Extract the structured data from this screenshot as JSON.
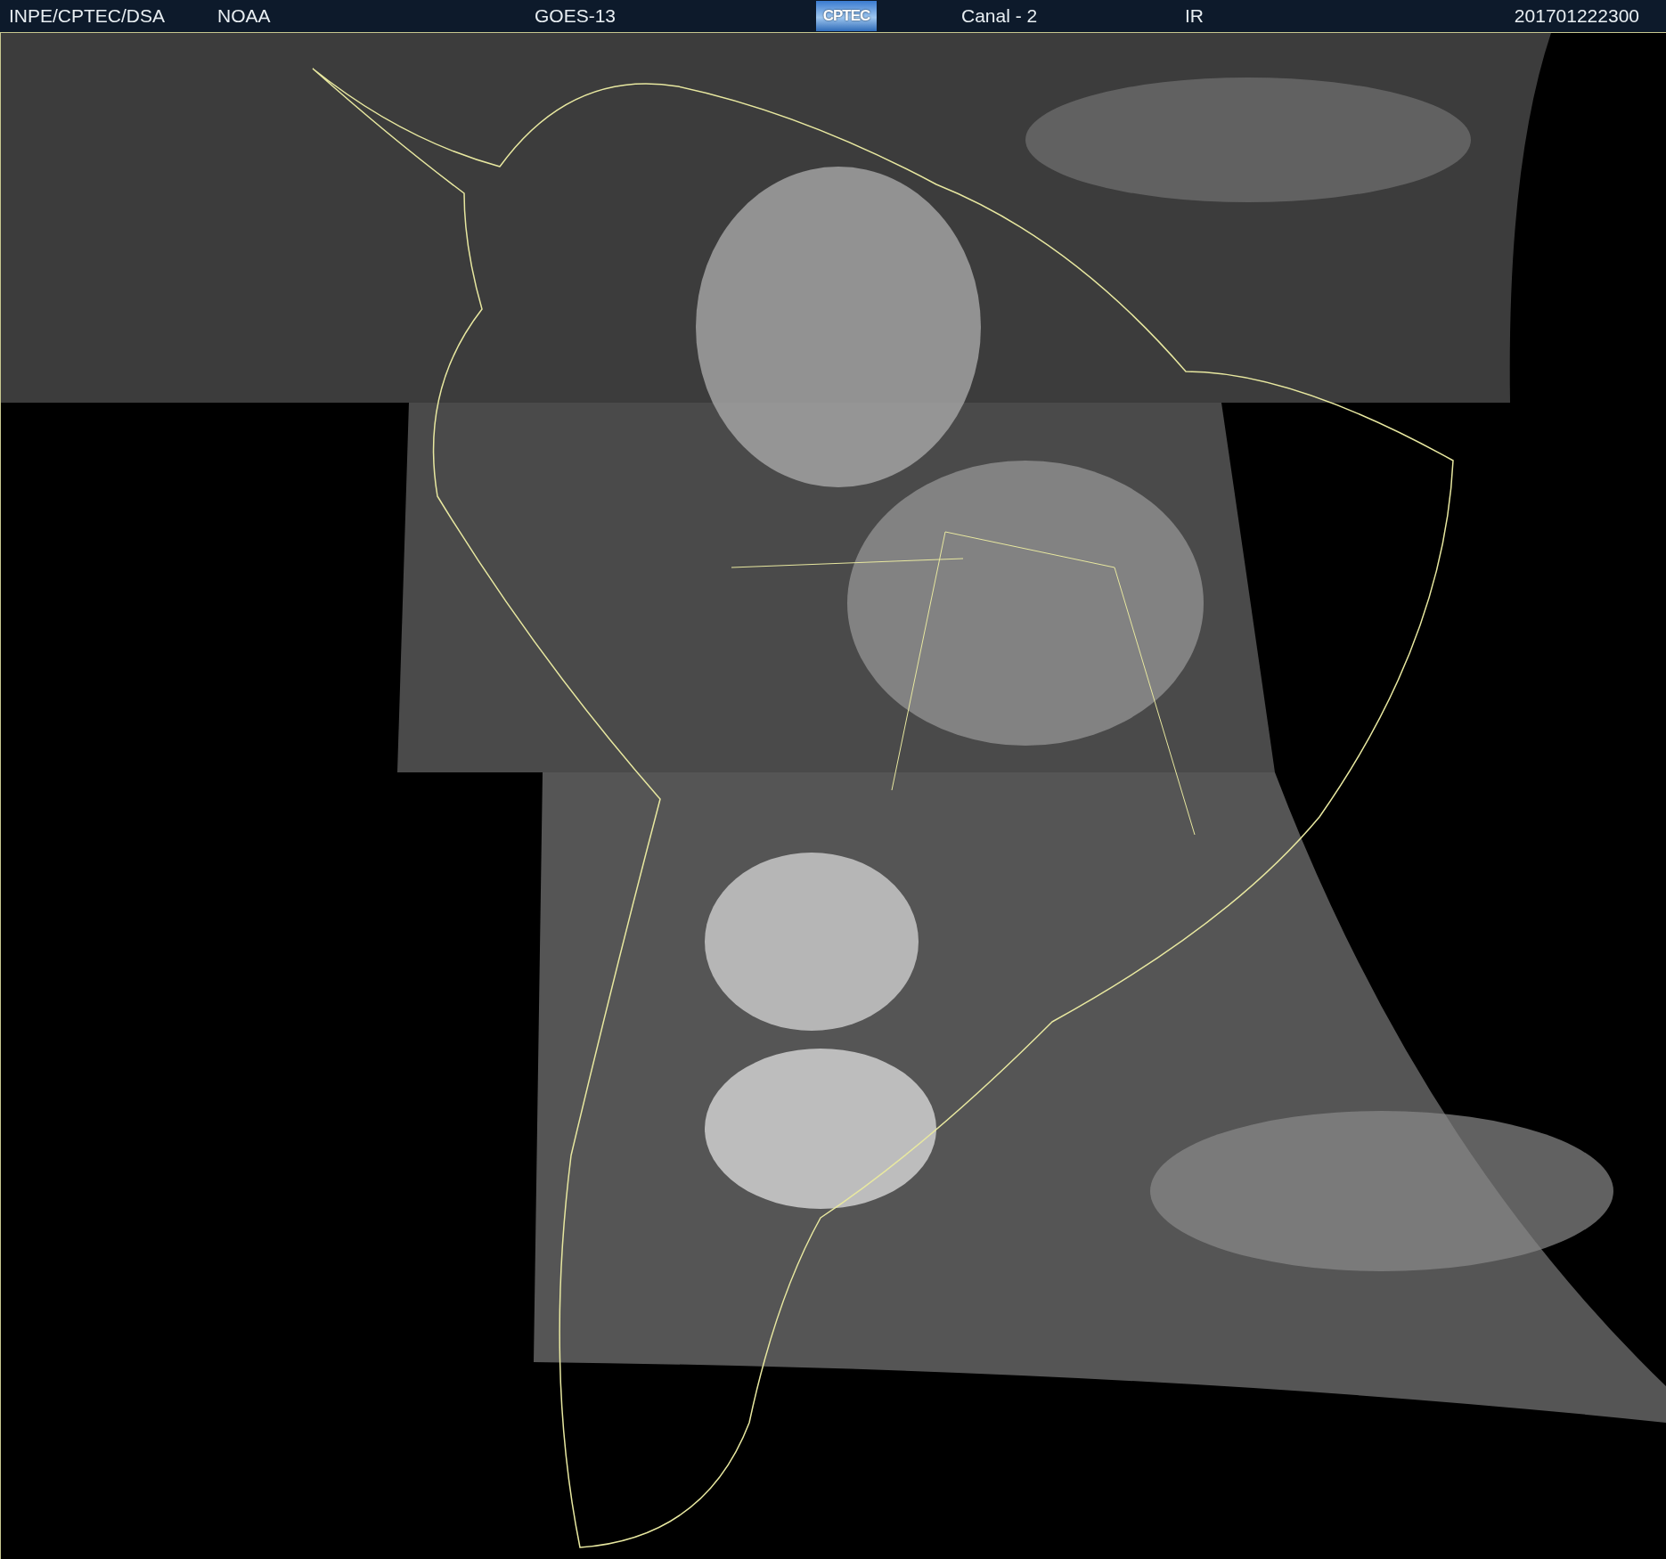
{
  "header": {
    "items": [
      {
        "kind": "text",
        "text": "INPE/CPTEC/DSA"
      },
      {
        "kind": "text",
        "text": "NOAA"
      },
      {
        "kind": "text",
        "text": "GOES-13"
      },
      {
        "kind": "logo",
        "text": "CPTEC"
      },
      {
        "kind": "text",
        "text": "Canal - 2"
      },
      {
        "kind": "text",
        "text": "IR"
      },
      {
        "kind": "text",
        "text": "201701222300"
      }
    ]
  }
}
